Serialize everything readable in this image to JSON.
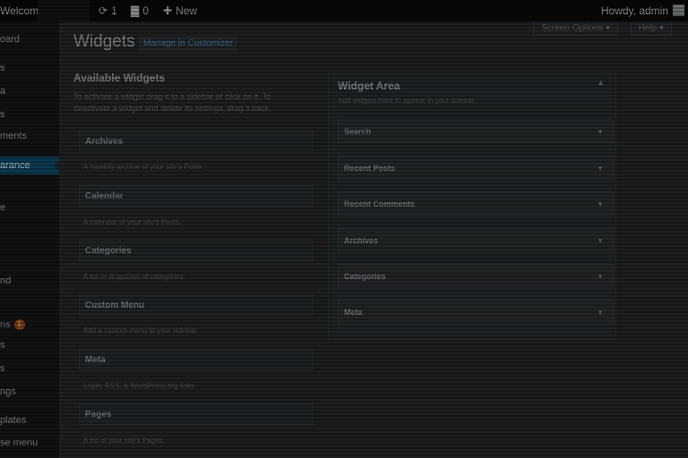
{
  "admin_bar": {
    "site_name": "Welcome",
    "updates_count": "1",
    "comments_count": "0",
    "new_label": "New",
    "howdy": "Howdy, admin"
  },
  "sidebar": {
    "items": [
      {
        "label": "oard"
      },
      {
        "label": "s"
      },
      {
        "label": "a"
      },
      {
        "label": "s"
      },
      {
        "label": "ments"
      },
      {
        "label": "arance"
      },
      {
        "label": "e"
      },
      {
        "label": "nd"
      },
      {
        "label": "ns",
        "badge": "1"
      },
      {
        "label": "s"
      },
      {
        "label": "s"
      },
      {
        "label": "ngs"
      },
      {
        "label": "plates"
      },
      {
        "label": "se menu"
      }
    ]
  },
  "header": {
    "title": "Widgets",
    "manage_link": "Manage in Customizer",
    "screen_options": "Screen Options",
    "help": "Help"
  },
  "available": {
    "title": "Available Widgets",
    "description": "To activate a widget drag it to a sidebar or click on it. To deactivate a widget and delete its settings, drag it back.",
    "widgets": [
      {
        "title": "Archives",
        "desc": "A monthly archive of your site's Posts."
      },
      {
        "title": "Calendar",
        "desc": "A calendar of your site's Posts."
      },
      {
        "title": "Categories",
        "desc": "A list or dropdown of categories."
      },
      {
        "title": "Custom Menu",
        "desc": "Add a custom menu to your sidebar."
      },
      {
        "title": "Meta",
        "desc": "Login, RSS, & WordPress.org links."
      },
      {
        "title": "Pages",
        "desc": "A list of your site's Pages."
      }
    ]
  },
  "widget_area": {
    "title": "Widget Area",
    "description": "Add widgets here to appear in your sidebar.",
    "widgets": [
      "Search",
      "Recent Posts",
      "Recent Comments",
      "Archives",
      "Categories",
      "Meta"
    ]
  }
}
